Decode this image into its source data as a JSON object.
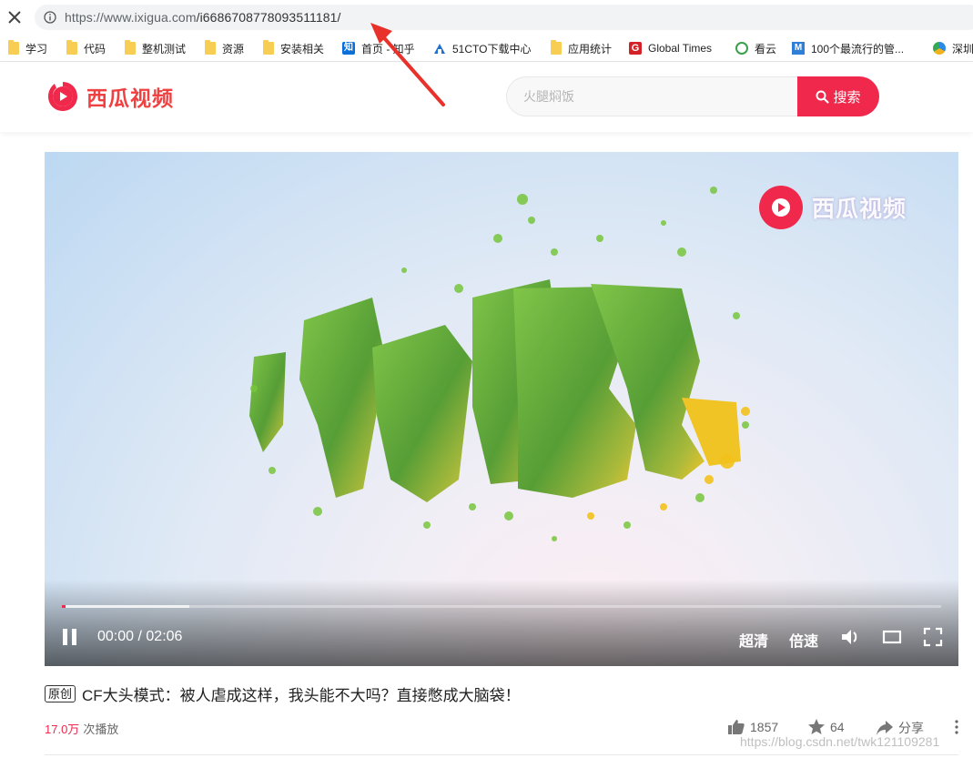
{
  "browser": {
    "url_host": "https://www.ixigua.com",
    "url_path": "/i6686708778093511181/",
    "bookmarks": [
      {
        "label": "学习",
        "icon": "folder-icon"
      },
      {
        "label": "代码",
        "icon": "folder-icon"
      },
      {
        "label": "整机测试",
        "icon": "folder-icon"
      },
      {
        "label": "资源",
        "icon": "folder-icon"
      },
      {
        "label": "安装相关",
        "icon": "folder-icon"
      },
      {
        "label": "首页 - 知乎",
        "icon": "zhihu-icon",
        "icon_text": "知"
      },
      {
        "label": "51CTO下载中心",
        "icon": "51cto-icon"
      },
      {
        "label": "应用统计",
        "icon": "folder-icon"
      },
      {
        "label": "Global Times",
        "icon": "global-times-icon",
        "icon_text": "G"
      },
      {
        "label": "看云",
        "icon": "kanyun-icon"
      },
      {
        "label": "100个最流行的管...",
        "icon": "m-icon",
        "icon_text": "M"
      },
      {
        "label": "深圳",
        "icon": "shenzhen-icon"
      }
    ]
  },
  "site": {
    "logo_text": "西瓜视频",
    "search_placeholder": "火腿焖饭",
    "search_button": "搜索",
    "brand_color": "#f0284c"
  },
  "player": {
    "watermark": "西瓜视频",
    "current_time": "00:00",
    "separator": " / ",
    "duration": "02:06",
    "played_fraction": 0.004,
    "buffered_fraction": 0.145,
    "quality_label": "超清",
    "speed_label": "倍速"
  },
  "video": {
    "badge": "原创",
    "title": "CF大头模式：被人虐成这样，我头能不大吗？直接憋成大脑袋！",
    "views": "17.0万",
    "views_label": "次播放",
    "likes": "1857",
    "favorites": "64",
    "share_label": "分享"
  },
  "watermark_csdn": "https://blog.csdn.net/twk121109281"
}
